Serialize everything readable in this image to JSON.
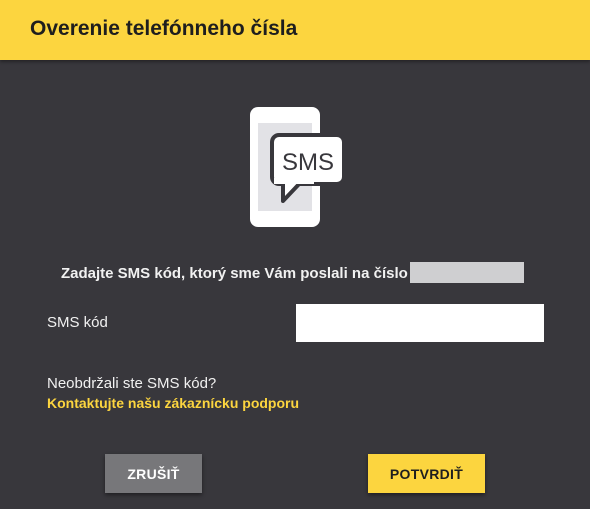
{
  "dialog": {
    "title": "Overenie telefónneho čísla"
  },
  "illustration": {
    "icon": "phone-sms-icon",
    "bubble_text": "SMS"
  },
  "instruction": {
    "text": "Zadajte SMS kód, ktorý sme Vám poslali na číslo"
  },
  "form": {
    "sms_label": "SMS kód",
    "sms_value": ""
  },
  "help": {
    "question": "Neobdržali ste SMS kód?",
    "link_text": "Kontaktujte našu zákaznícku podporu"
  },
  "buttons": {
    "cancel_label": "ZRUŠIŤ",
    "confirm_label": "POTVRDIŤ"
  },
  "colors": {
    "accent": "#fcd53f",
    "background": "#38373c",
    "cancel_button": "#77777a",
    "phone_body": "#ffffff",
    "phone_screen": "#e2e2e6",
    "bubble_border": "#38373c"
  }
}
